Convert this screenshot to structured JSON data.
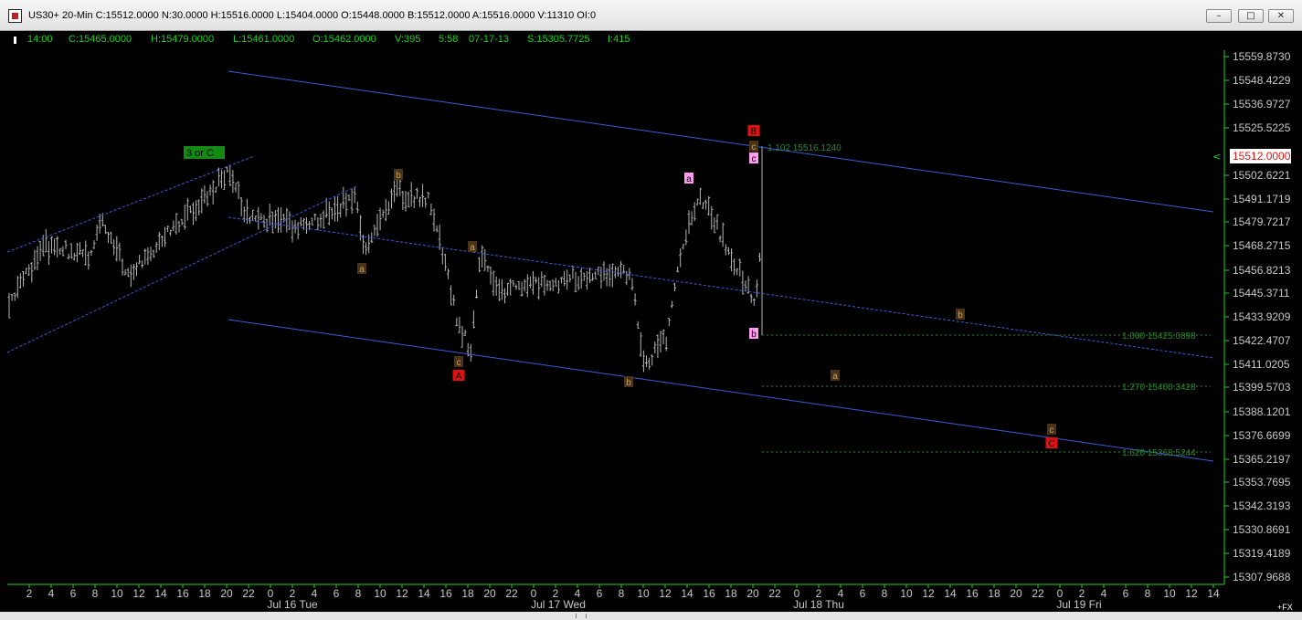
{
  "window": {
    "title": "US30+ 20-Min C:15512.0000 N:30.0000 H:15516.0000 L:15404.0000 O:15448.0000 B:15512.0000 A:15516.0000 V:11310 OI:0",
    "buttons": {
      "minimize": "–",
      "maximize": "□",
      "close": "✕"
    }
  },
  "infobar": {
    "time": "14:00",
    "close": "C:15465.0000",
    "high": "H:15479.0000",
    "low": "L:15461.0000",
    "open": "O:15462.0000",
    "volume": "V:395",
    "clock": "5:58",
    "date": "07-17-13",
    "s": "S:15305.7725",
    "i": "I:415"
  },
  "price_axis": {
    "labels": [
      "15559.8730",
      "15548.4229",
      "15536.9727",
      "15525.5225",
      "15502.6221",
      "15491.1719",
      "15479.7217",
      "15468.2715",
      "15456.8213",
      "15445.3711",
      "15433.9209",
      "15422.4707",
      "15411.0205",
      "15399.5703",
      "15388.1201",
      "15376.6699",
      "15365.2197",
      "15353.7695",
      "15342.3193",
      "15330.8691",
      "15319.4189",
      "15307.9688"
    ],
    "current_price": "15512.0000",
    "current_marker": "<"
  },
  "time_axis": {
    "hour_labels": [
      "2",
      "4",
      "6",
      "8",
      "10",
      "12",
      "14",
      "16",
      "18",
      "20",
      "22",
      "0",
      "2",
      "4",
      "6",
      "8",
      "10",
      "12",
      "14",
      "16",
      "18",
      "20",
      "22",
      "0",
      "2",
      "4",
      "6",
      "8",
      "10",
      "12",
      "14",
      "16",
      "18",
      "20",
      "22",
      "0",
      "2",
      "4",
      "6",
      "8",
      "10",
      "12",
      "14",
      "16",
      "18",
      "20",
      "22",
      "0",
      "2",
      "4",
      "6",
      "8",
      "10",
      "12",
      "14"
    ],
    "day_labels": [
      "Jul 16 Tue",
      "Jul 17 Wed",
      "Jul 18 Thu",
      "Jul 19 Fri"
    ],
    "fx_label": "+FX"
  },
  "annotations": {
    "wave_3_or_c": "3 or C",
    "labels": [
      "a",
      "b",
      "c",
      "A",
      "a",
      "b",
      "a",
      "b",
      "c",
      "B",
      "c",
      "b",
      "a",
      "b",
      "c",
      "C"
    ]
  },
  "fib_levels": [
    {
      "label": "1.102  15516.1240"
    },
    {
      "label": "1.000  15425.0898"
    },
    {
      "label": "1.270  15400.3428"
    },
    {
      "label": "1.620  15368.5244"
    }
  ],
  "colors": {
    "background": "#000000",
    "text_green": "#1fd11f",
    "channel_blue": "#3a5bd8",
    "bar_gray": "#b4b4b4",
    "label_brown": "#4a3318",
    "label_red": "#e01010",
    "label_pink": "#ff9cf0",
    "fib_green": "#2a8a2a"
  }
}
